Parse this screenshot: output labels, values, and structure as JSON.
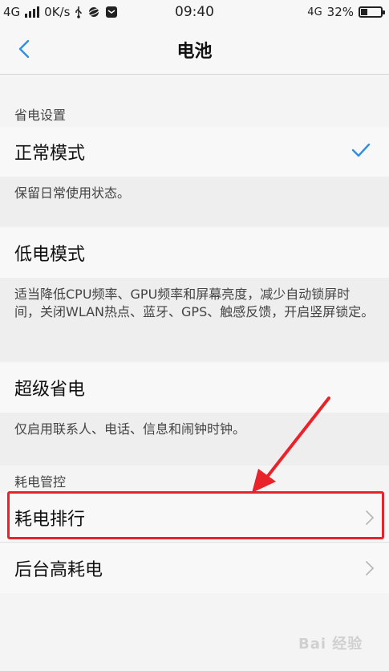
{
  "status_bar": {
    "network_left": "4G",
    "speed": "0K/s",
    "time": "09:40",
    "network_right": "4G",
    "battery_percent": "32%",
    "battery_level": 0.32
  },
  "nav": {
    "title": "电池",
    "back_icon": "chevron-left-icon"
  },
  "power_settings": {
    "section_label": "省电设置",
    "modes": [
      {
        "title": "正常模式",
        "description": "保留日常使用状态。",
        "selected": true
      },
      {
        "title": "低电模式",
        "description": "适当降低CPU频率、GPU频率和屏幕亮度，减少自动锁屏时间，关闭WLAN热点、蓝牙、GPS、触感反馈，开启竖屏锁定。",
        "selected": false
      },
      {
        "title": "超级省电",
        "description": "仅启用联系人、电话、信息和闹钟时钟。",
        "selected": false
      }
    ]
  },
  "power_control": {
    "section_label": "耗电管控",
    "items": [
      {
        "label": "耗电排行"
      },
      {
        "label": "后台高耗电"
      }
    ]
  },
  "annotation": {
    "highlight_color": "#e8232a"
  },
  "watermark": {
    "text": "Bai 经验"
  },
  "colors": {
    "accent": "#2f8fe6"
  }
}
